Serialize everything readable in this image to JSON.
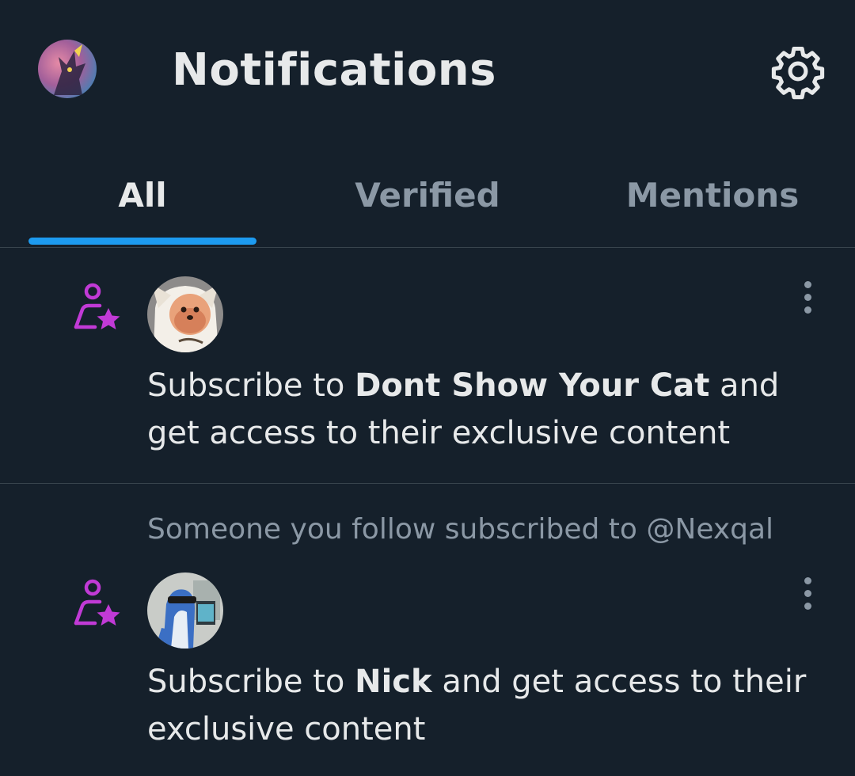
{
  "header": {
    "title": "Notifications",
    "avatar_icon": "user-avatar",
    "settings_icon": "gear-icon"
  },
  "tabs": [
    {
      "label": "All",
      "active": true
    },
    {
      "label": "Verified",
      "active": false
    },
    {
      "label": "Mentions",
      "active": false
    }
  ],
  "notifications": [
    {
      "type_icon": "subscription-person-star-icon",
      "context": "",
      "prefix": "Subscribe to ",
      "name": "Dont Show Your Cat",
      "suffix": " and get access to their exclusive content"
    },
    {
      "type_icon": "subscription-person-star-icon",
      "context": "Someone you follow subscribed to @Nexqal",
      "prefix": "Subscribe to ",
      "name": "Nick",
      "suffix": " and get access to their exclusive content"
    }
  ],
  "colors": {
    "background": "#15202b",
    "text_primary": "#e7e9ea",
    "text_secondary": "#8b98a5",
    "accent": "#1d9bf0",
    "subscription_icon": "#c13ad6",
    "divider": "#38444d"
  }
}
